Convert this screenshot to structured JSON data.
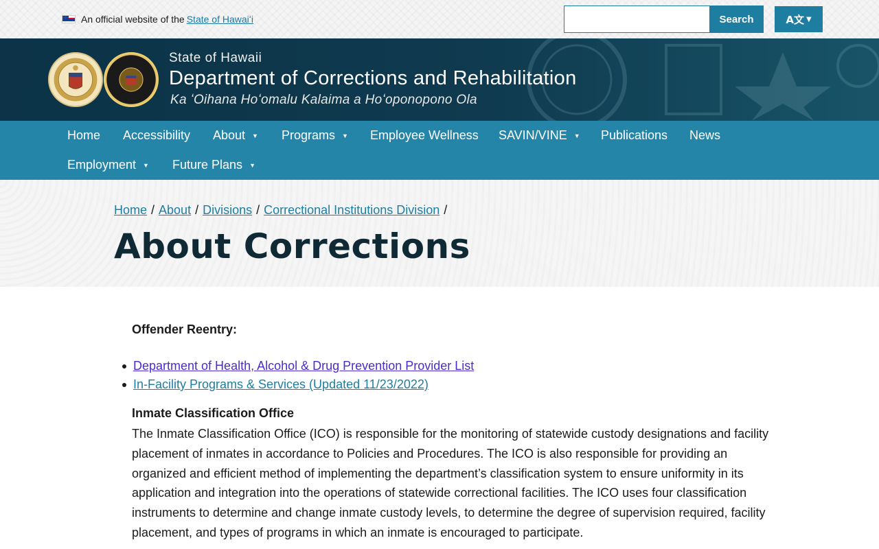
{
  "official_banner": {
    "text": "An official website of the",
    "link": "State of Hawaiʻi"
  },
  "search": {
    "placeholder": "",
    "button_label": "Search"
  },
  "language_button": {
    "label": "A文"
  },
  "header": {
    "state": "State of Hawaii",
    "department": "Department of Corrections and Rehabilitation",
    "hawaiian_name": "Ka ʻOihana Hoʻomalu Kalaima a Hoʻoponopono Ola"
  },
  "nav": {
    "items": [
      {
        "label": "Home",
        "has_menu": false
      },
      {
        "label": "Accessibility",
        "has_menu": false
      },
      {
        "label": "About",
        "has_menu": true
      },
      {
        "label": "Programs",
        "has_menu": true
      },
      {
        "label": "Employee Wellness",
        "has_menu": false
      },
      {
        "label": "SAVIN/VINE",
        "has_menu": true
      },
      {
        "label": "Publications",
        "has_menu": false
      },
      {
        "label": "News",
        "has_menu": false
      },
      {
        "label": "Employment",
        "has_menu": true
      },
      {
        "label": "Future Plans",
        "has_menu": true
      }
    ]
  },
  "breadcrumb": {
    "items": [
      "Home",
      "About",
      "Divisions",
      "Correctional Institutions Division"
    ],
    "separator": "/"
  },
  "page_title": "About Corrections",
  "content": {
    "reentry_heading": "Offender Reentry:",
    "links": [
      "Department of Health, Alcohol & Drug Prevention Provider List ",
      "In-Facility Programs & Services (Updated 11/23/2022)"
    ],
    "ico_heading": "Inmate Classification Office",
    "ico_paragraph": "The Inmate Classification Office (ICO) is responsible for the monitoring of statewide custody designations and facility placement of inmates in accordance to Policies and Procedures. The ICO is also responsible for providing an organized and efficient method of implementing the department’s classification system to ensure uniformity in its application and integration into the operations of statewide correctional facilities. The ICO uses four classification instruments to determine and change inmate custody levels, to determine the degree of supervision required, facility placement, and types of programs in which an inmate is encouraged to participate."
  },
  "colors": {
    "header_bg": "#0f3a4f",
    "nav_bg": "#2485a9",
    "accent": "#1e7ea1",
    "visited_link": "#4a2bd0"
  },
  "icons": [
    "hawaii-flag-icon",
    "caret-down-icon",
    "state-seal-logo",
    "department-seal-logo"
  ]
}
